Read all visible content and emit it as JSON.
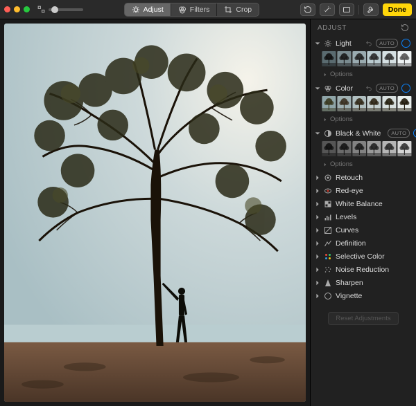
{
  "toolbar": {
    "tabs": {
      "adjust": "Adjust",
      "filters": "Filters",
      "crop": "Crop"
    },
    "done": "Done"
  },
  "sidebar": {
    "title": "ADJUST",
    "sections": {
      "light": {
        "label": "Light",
        "auto": "AUTO",
        "options": "Options"
      },
      "color": {
        "label": "Color",
        "auto": "AUTO",
        "options": "Options"
      },
      "bw": {
        "label": "Black & White",
        "auto": "AUTO",
        "options": "Options"
      }
    },
    "rows": {
      "retouch": "Retouch",
      "redeye": "Red-eye",
      "wb": "White Balance",
      "levels": "Levels",
      "curves": "Curves",
      "definition": "Definition",
      "selcolor": "Selective Color",
      "noise": "Noise Reduction",
      "sharpen": "Sharpen",
      "vignette": "Vignette"
    },
    "reset": "Reset Adjustments"
  },
  "colors": {
    "accent": "#0a84ff",
    "done": "#ffd60a"
  }
}
